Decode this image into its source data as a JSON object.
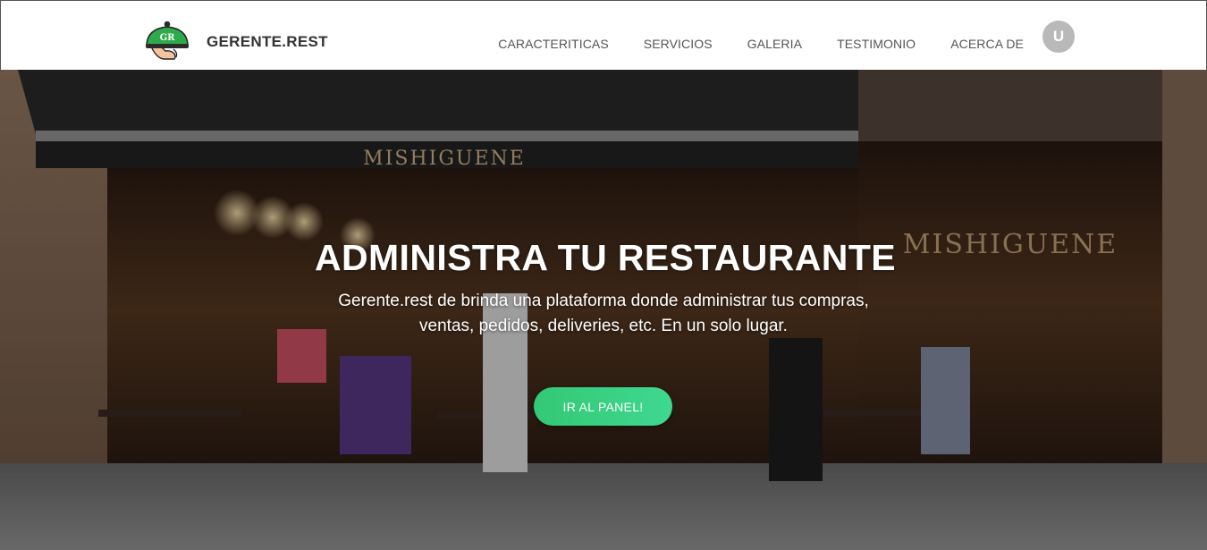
{
  "header": {
    "brand_name": "GERENTE.REST",
    "logo_monogram": "GR",
    "nav_items": [
      {
        "label": "CARACTERITICAS"
      },
      {
        "label": "SERVICIOS"
      },
      {
        "label": "GALERIA"
      },
      {
        "label": "TESTIMONIO"
      },
      {
        "label": "ACERCA DE"
      }
    ],
    "user_initial": "U"
  },
  "hero": {
    "title": "ADMINISTRA TU RESTAURANTE",
    "subtitle": "Gerente.rest de brinda una plataforma donde administrar tus compras, ventas, pedidos, deliveries, etc. En un solo lugar.",
    "cta_label": "IR AL PANEL!",
    "background": {
      "sign_text": "MISHIGUENE",
      "window_sign_text": "MISHIGUENE"
    }
  },
  "colors": {
    "accent_green": "#33c874",
    "avatar_gray": "#b9b9b9",
    "nav_text": "#555555",
    "brand_text": "#333333"
  }
}
